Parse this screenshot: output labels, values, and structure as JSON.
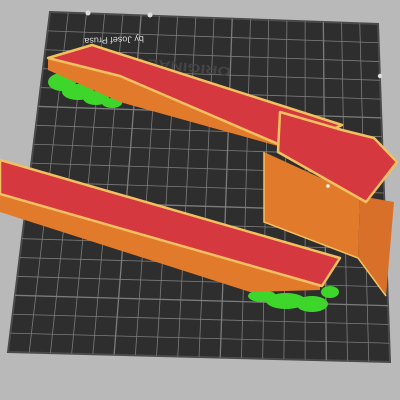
{
  "viewport": {
    "bed": {
      "logo_text": "ORIGINAL PRUSA",
      "logo_subtitle": "by Josef Prusa"
    },
    "colors": {
      "background": "#b9b9b9",
      "bed_surface": "#2e2e2e",
      "grid_line": "#7c7c7c",
      "bed_edge": "#4a4a4a",
      "part_top": "#d5383e",
      "part_side": "#e27a2b",
      "part_edge": "#f2c060",
      "support": "#3fd62b"
    },
    "parts": [
      {
        "name": "long-channel-back"
      },
      {
        "name": "long-channel-front"
      },
      {
        "name": "corner-bracket"
      }
    ]
  }
}
